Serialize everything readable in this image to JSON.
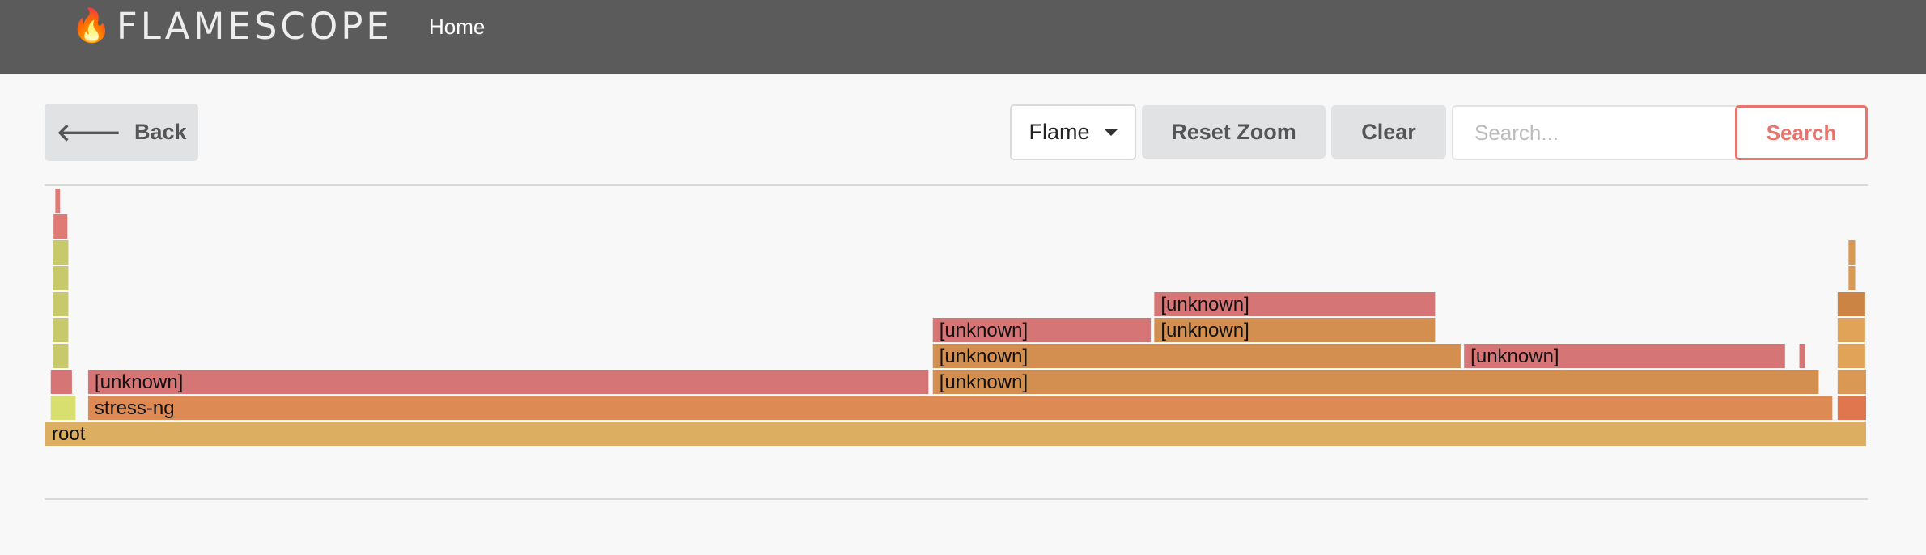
{
  "navbar": {
    "brand_text": "FLAMESCOPE",
    "brand_icon": "fire-icon",
    "home_label": "Home"
  },
  "toolbar": {
    "back_label": "Back",
    "mode_label": "Flame",
    "reset_zoom_label": "Reset Zoom",
    "clear_label": "Clear",
    "search_placeholder": "Search...",
    "search_label": "Search"
  },
  "colors": {
    "navbar": "#5b5b5b",
    "search_accent": "#e9736d",
    "frame_red": "#d67575",
    "frame_orange": "#d38f50",
    "frame_orange2": "#de8a55",
    "frame_root": "#dcae62",
    "frame_yellow": "#c8c96b"
  },
  "flamegraph": {
    "frames": [
      {
        "label": "root",
        "depth": 0,
        "start": 0.0,
        "end": 1.0,
        "color": "#dcae62"
      },
      {
        "label": "",
        "depth": 1,
        "start": 0.003,
        "end": 0.0175,
        "color": "#d8df6f"
      },
      {
        "label": "stress-ng",
        "depth": 1,
        "start": 0.0235,
        "end": 0.9815,
        "color": "#de8a55"
      },
      {
        "label": "",
        "depth": 1,
        "start": 0.9835,
        "end": 1.0,
        "color": "#e0764e"
      },
      {
        "label": "",
        "depth": 2,
        "start": 0.003,
        "end": 0.0155,
        "color": "#d67575"
      },
      {
        "label": "[unknown]",
        "depth": 2,
        "start": 0.0235,
        "end": 0.4855,
        "color": "#d67575"
      },
      {
        "label": "[unknown]",
        "depth": 2,
        "start": 0.487,
        "end": 0.974,
        "color": "#d38f50"
      },
      {
        "label": "",
        "depth": 2,
        "start": 0.9835,
        "end": 1.0,
        "color": "#d99853"
      },
      {
        "label": "",
        "depth": 3,
        "start": 0.004,
        "end": 0.0135,
        "color": "#c8c96b"
      },
      {
        "label": "[unknown]",
        "depth": 3,
        "start": 0.487,
        "end": 0.7775,
        "color": "#d38f50"
      },
      {
        "label": "[unknown]",
        "depth": 3,
        "start": 0.7785,
        "end": 0.9555,
        "color": "#d67575"
      },
      {
        "label": "",
        "depth": 3,
        "start": 0.9625,
        "end": 0.9665,
        "color": "#d67575"
      },
      {
        "label": "",
        "depth": 3,
        "start": 0.9835,
        "end": 0.9995,
        "color": "#e0a357"
      },
      {
        "label": "",
        "depth": 4,
        "start": 0.004,
        "end": 0.0135,
        "color": "#c8c96b"
      },
      {
        "label": "[unknown]",
        "depth": 4,
        "start": 0.487,
        "end": 0.6075,
        "color": "#d67575"
      },
      {
        "label": "[unknown]",
        "depth": 4,
        "start": 0.6085,
        "end": 0.7635,
        "color": "#d38f50"
      },
      {
        "label": "",
        "depth": 4,
        "start": 0.9835,
        "end": 0.9995,
        "color": "#e0a357"
      },
      {
        "label": "",
        "depth": 5,
        "start": 0.004,
        "end": 0.0135,
        "color": "#c8c96b"
      },
      {
        "label": "[unknown]",
        "depth": 5,
        "start": 0.6085,
        "end": 0.7635,
        "color": "#d67575"
      },
      {
        "label": "",
        "depth": 5,
        "start": 0.9835,
        "end": 0.9995,
        "color": "#cc8445"
      },
      {
        "label": "",
        "depth": 6,
        "start": 0.004,
        "end": 0.0135,
        "color": "#c8c96b"
      },
      {
        "label": "",
        "depth": 6,
        "start": 0.9895,
        "end": 0.994,
        "color": "#d99853"
      },
      {
        "label": "",
        "depth": 7,
        "start": 0.004,
        "end": 0.0135,
        "color": "#c8c96b"
      },
      {
        "label": "",
        "depth": 7,
        "start": 0.9895,
        "end": 0.994,
        "color": "#d99853"
      },
      {
        "label": "",
        "depth": 8,
        "start": 0.0045,
        "end": 0.013,
        "color": "#e07a75"
      },
      {
        "label": "",
        "depth": 9,
        "start": 0.0055,
        "end": 0.009,
        "color": "#e07a75"
      }
    ]
  }
}
